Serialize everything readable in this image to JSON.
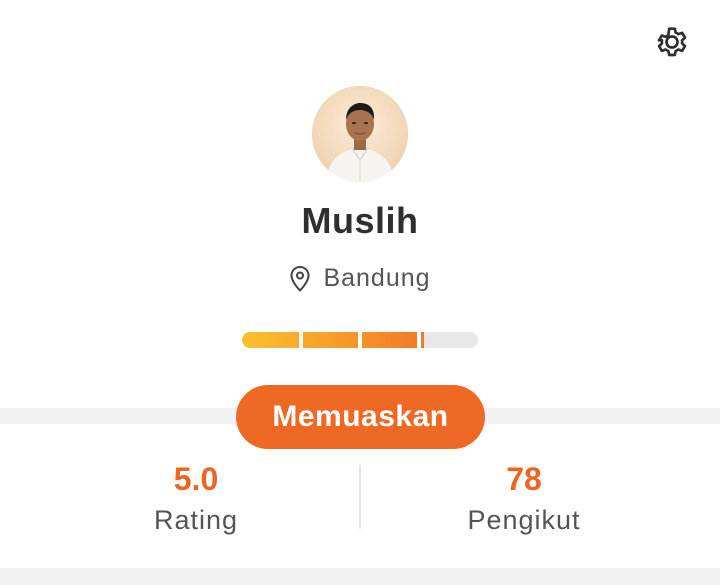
{
  "header": {
    "settings_icon": "gear-icon"
  },
  "profile": {
    "name": "Muslih",
    "location": "Bandung",
    "location_icon": "map-pin-icon",
    "level_progress": 0.77,
    "level_segments": 4,
    "badge_label": "Memuaskan",
    "badge_color": "#ee6a24"
  },
  "stats": {
    "rating": {
      "value": "5.0",
      "label": "Rating"
    },
    "followers": {
      "value": "78",
      "label": "Pengikut"
    }
  },
  "colors": {
    "accent": "#ec6524",
    "bar_start": "#fcc02e",
    "bar_end": "#f07a24",
    "bar_track": "#e8e8e8"
  }
}
